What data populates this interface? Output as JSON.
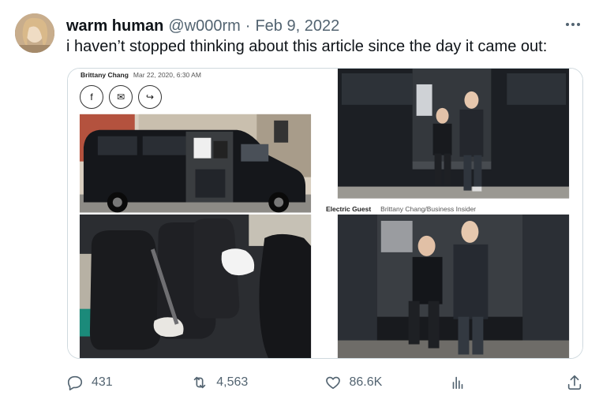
{
  "tweet": {
    "display_name": "warm human",
    "handle": "@w000rm",
    "separator": "·",
    "date": "Feb 9, 2022",
    "text": "i haven’t stopped thinking about this article since the day it came out:"
  },
  "media": {
    "article_author": "Brittany Chang",
    "article_date": "Mar 22, 2020, 6:30 AM",
    "share_icons": [
      "facebook-icon",
      "email-icon",
      "share-arrow-icon"
    ],
    "share_glyphs": [
      "f",
      "✉",
      "↪"
    ],
    "photo_caption_title": "Electric Guest",
    "photo_caption_credit": "Brittany Chang/Business Insider",
    "images": [
      "van-exterior-street",
      "band-seated-in-van-door",
      "van-interior-seats",
      "band-closeup-in-van-door"
    ]
  },
  "actions": {
    "reply_count": "431",
    "retweet_count": "4,563",
    "like_count": "86.6K",
    "views_label": ""
  },
  "colors": {
    "text": "#0f1419",
    "secondary": "#536471",
    "border": "#cfd9de"
  }
}
